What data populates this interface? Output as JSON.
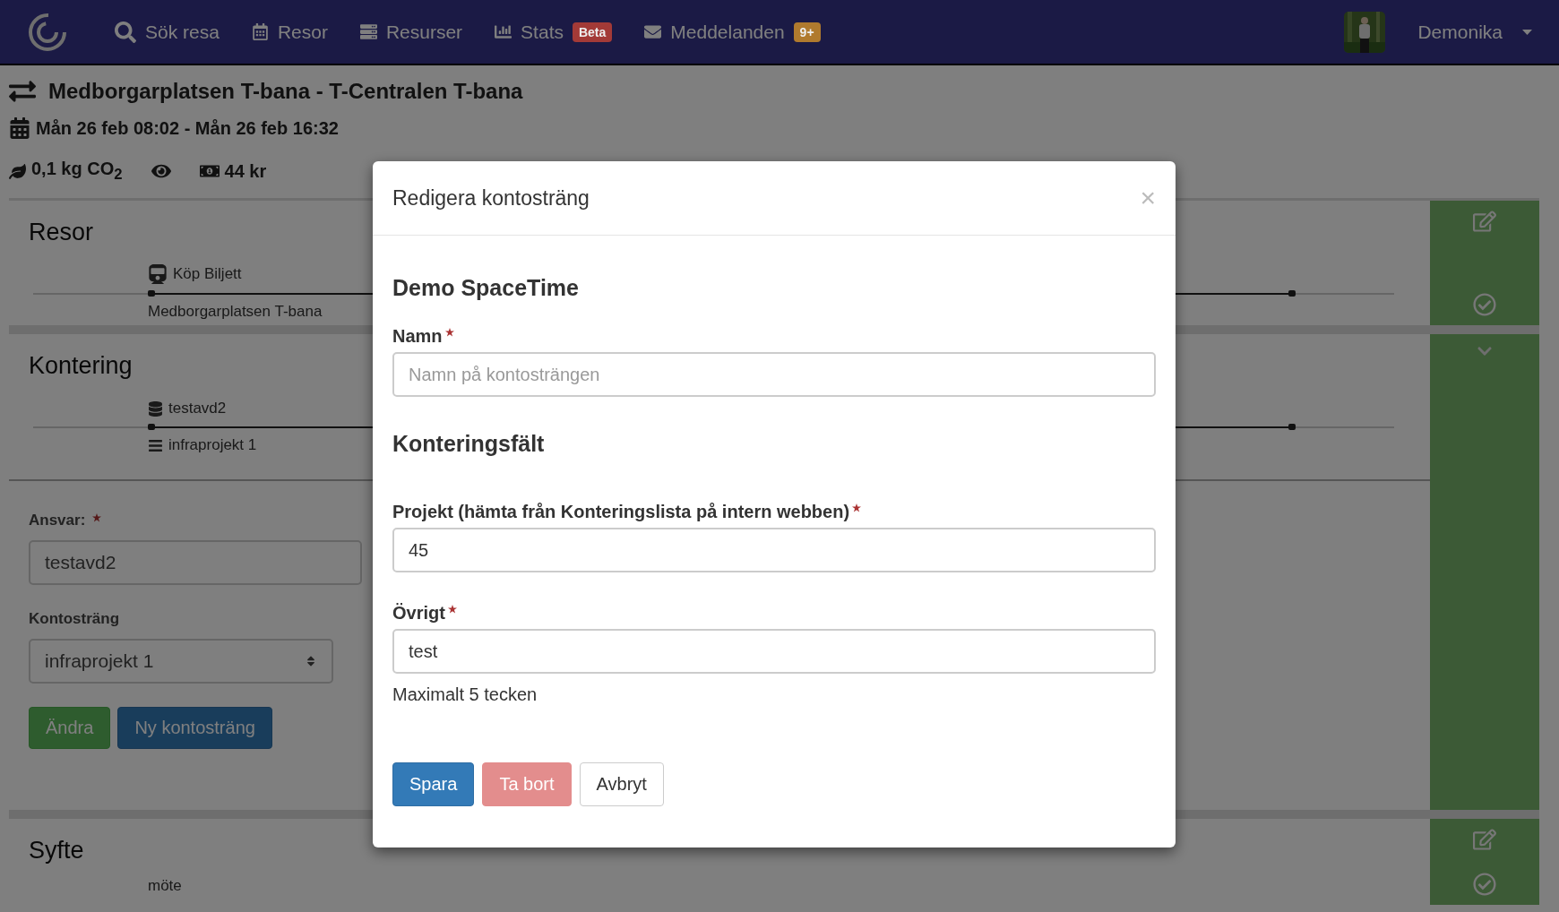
{
  "nav": {
    "items": [
      {
        "label": "Sök resa"
      },
      {
        "label": "Resor"
      },
      {
        "label": "Resurser"
      },
      {
        "label": "Stats",
        "badge": {
          "text": "Beta",
          "color": "#a33a37"
        }
      },
      {
        "label": "Meddelanden",
        "badge": {
          "text": "9+",
          "color": "#b07a2e"
        }
      }
    ],
    "user": {
      "name": "Demonika"
    }
  },
  "trip": {
    "route": "Medborgarplatsen T-bana - T-Centralen T-bana",
    "dates": "Mån 26 feb 08:02 - Mån 26 feb 16:32",
    "co2": "0,1 kg CO$_{2}$",
    "cost": "44 kr"
  },
  "sections": [
    {
      "kind": "timeline",
      "title": "Resor",
      "expanded": false,
      "above": "Köp Biljett",
      "below": "Medborgarplatsen T-bana"
    },
    {
      "kind": "accounting",
      "title": "Kontering",
      "expanded": true,
      "above": "testavd2",
      "below": "infraprojekt 1",
      "form": {
        "fields": [
          {
            "kind": "input",
            "label": "Ansvar:",
            "required": true,
            "value": "testavd2"
          },
          {
            "kind": "select",
            "label": "Kontosträng",
            "required": false,
            "value": "infraprojekt 1"
          }
        ],
        "buttons": [
          {
            "label": "Ändra",
            "kind": "success"
          },
          {
            "label": "Ny kontosträng",
            "kind": "primary"
          }
        ]
      }
    },
    {
      "kind": "text",
      "title": "Syfte",
      "expanded": false,
      "text": "möte"
    }
  ],
  "modal": {
    "title": "Redigera kontosträng",
    "close": "×",
    "heading": "Demo SpaceTime",
    "fields": [
      {
        "label": "Namn",
        "required": true,
        "placeholder": "Namn på kontosträngen"
      }
    ],
    "subheading": "Konteringsfält",
    "extra_fields": [
      {
        "label": "Projekt (hämta från Konteringslista på intern webben)",
        "required": true,
        "value": "45"
      },
      {
        "label": "Övrigt",
        "required": true,
        "value": "test",
        "help": "Maximalt 5 tecken"
      }
    ],
    "buttons": [
      {
        "label": "Spara",
        "kind": "primary"
      },
      {
        "label": "Ta bort",
        "kind": "danger"
      },
      {
        "label": "Avbryt",
        "kind": "default"
      }
    ]
  }
}
